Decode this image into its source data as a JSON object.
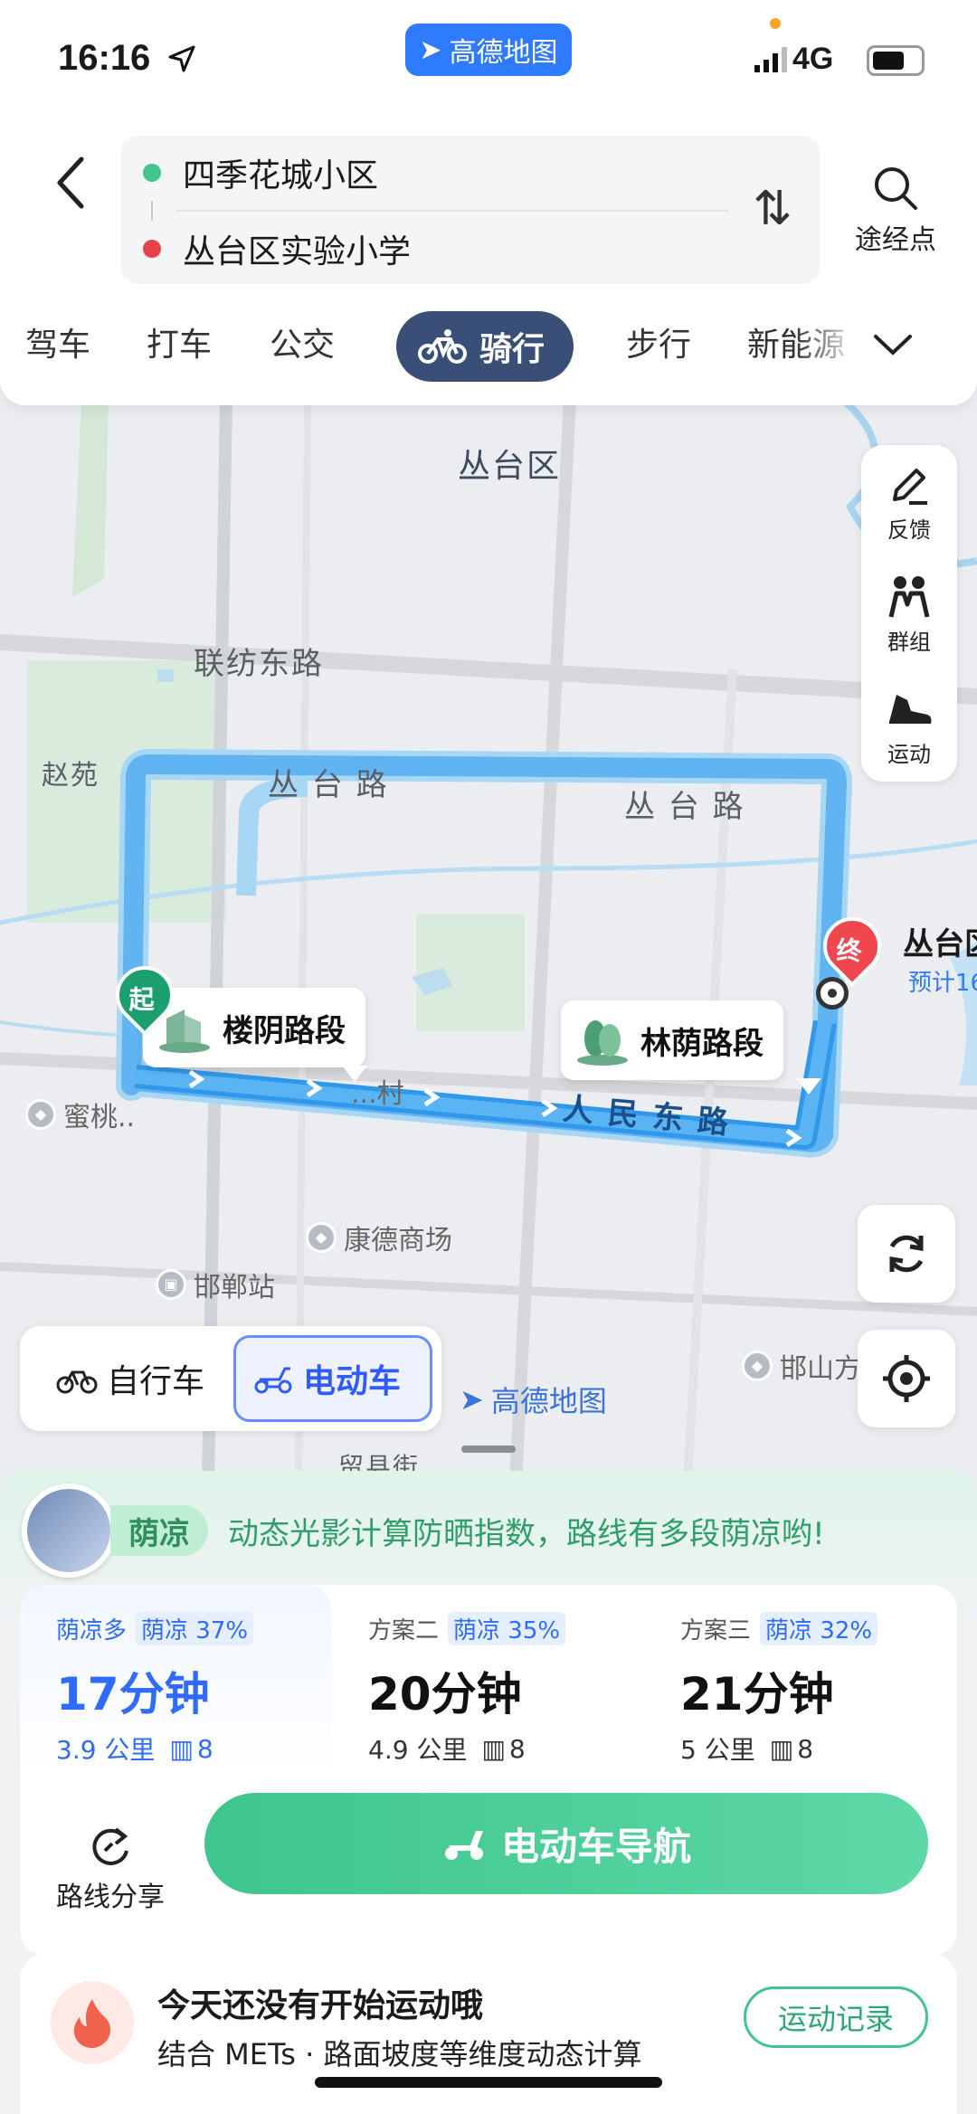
{
  "status": {
    "time": "16:16",
    "network": "4G",
    "app_badge": "高德地图"
  },
  "header": {
    "origin": "四季花城小区",
    "destination": "丛台区实验小学",
    "via_label": "途经点",
    "modes": [
      "驾车",
      "打车",
      "公交",
      "骑行",
      "步行",
      "新能源"
    ],
    "active_mode": "骑行"
  },
  "map": {
    "district": "丛台区",
    "roads": [
      "联纺东路",
      "丛 台 路",
      "丛 台 路",
      "人 民 东 路",
      "留县街"
    ],
    "places": [
      "赵苑",
      "康德商场",
      "邯郸站",
      "蜜桃..",
      "邯山方...场",
      "...村"
    ],
    "bubbles": [
      "楼阴路段",
      "林荫路段"
    ],
    "start_marker": "起",
    "end_marker": "终",
    "end_label": "丛台区...",
    "end_sub": "预计16...",
    "tools": [
      "反馈",
      "群组",
      "运动"
    ],
    "bike_types": [
      "自行车",
      "电动车"
    ],
    "active_bike": "电动车",
    "watermark": "高德地图"
  },
  "shade": {
    "tag": "荫凉",
    "message": "动态光影计算防晒指数，路线有多段荫凉哟!"
  },
  "plans": [
    {
      "name": "荫凉多",
      "shade": "荫凉 37%",
      "time": "17分钟",
      "distance": "3.9 公里",
      "lights": "8",
      "selected": true
    },
    {
      "name": "方案二",
      "shade": "荫凉 35%",
      "time": "20分钟",
      "distance": "4.9 公里",
      "lights": "8",
      "selected": false
    },
    {
      "name": "方案三",
      "shade": "荫凉 32%",
      "time": "21分钟",
      "distance": "5 公里",
      "lights": "8",
      "selected": false
    }
  ],
  "actions": {
    "share": "路线分享",
    "navigate": "电动车导航"
  },
  "sport": {
    "title": "今天还没有开始运动哦",
    "subtitle": "结合 METs · 路面坡度等维度动态计算",
    "button": "运动记录"
  },
  "colors": {
    "route": "#4aa8f0",
    "accent": "#2f6bff",
    "nav_green": "#3fc58d",
    "mode_active": "#3a4f77"
  }
}
